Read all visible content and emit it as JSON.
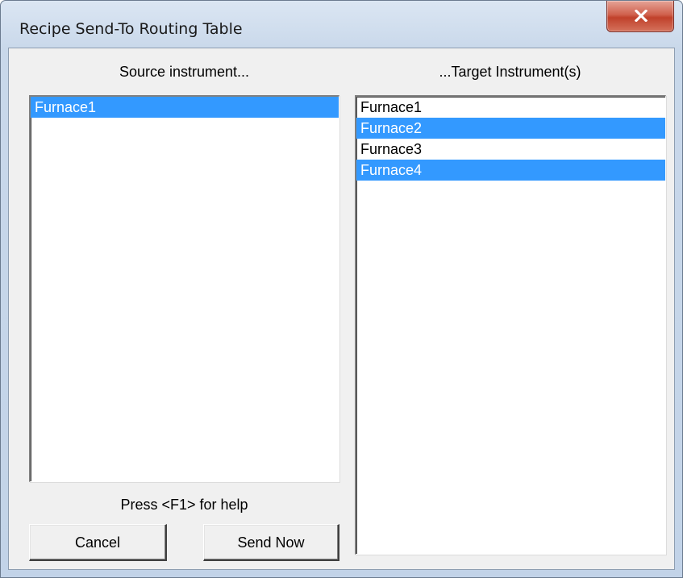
{
  "window": {
    "title": "Recipe Send-To Routing Table",
    "close_icon": "close-x-icon"
  },
  "source": {
    "heading": "Source instrument...",
    "items": [
      {
        "label": "Furnace1",
        "selected": true
      }
    ]
  },
  "target": {
    "heading": "...Target Instrument(s)",
    "items": [
      {
        "label": "Furnace1",
        "selected": false
      },
      {
        "label": "Furnace2",
        "selected": true
      },
      {
        "label": "Furnace3",
        "selected": false
      },
      {
        "label": "Furnace4",
        "selected": true
      }
    ]
  },
  "help_text": "Press <F1> for help",
  "buttons": {
    "cancel_label": "Cancel",
    "send_label": "Send Now"
  },
  "colors": {
    "selection": "#3399ff",
    "close_button": "#c7432e"
  }
}
